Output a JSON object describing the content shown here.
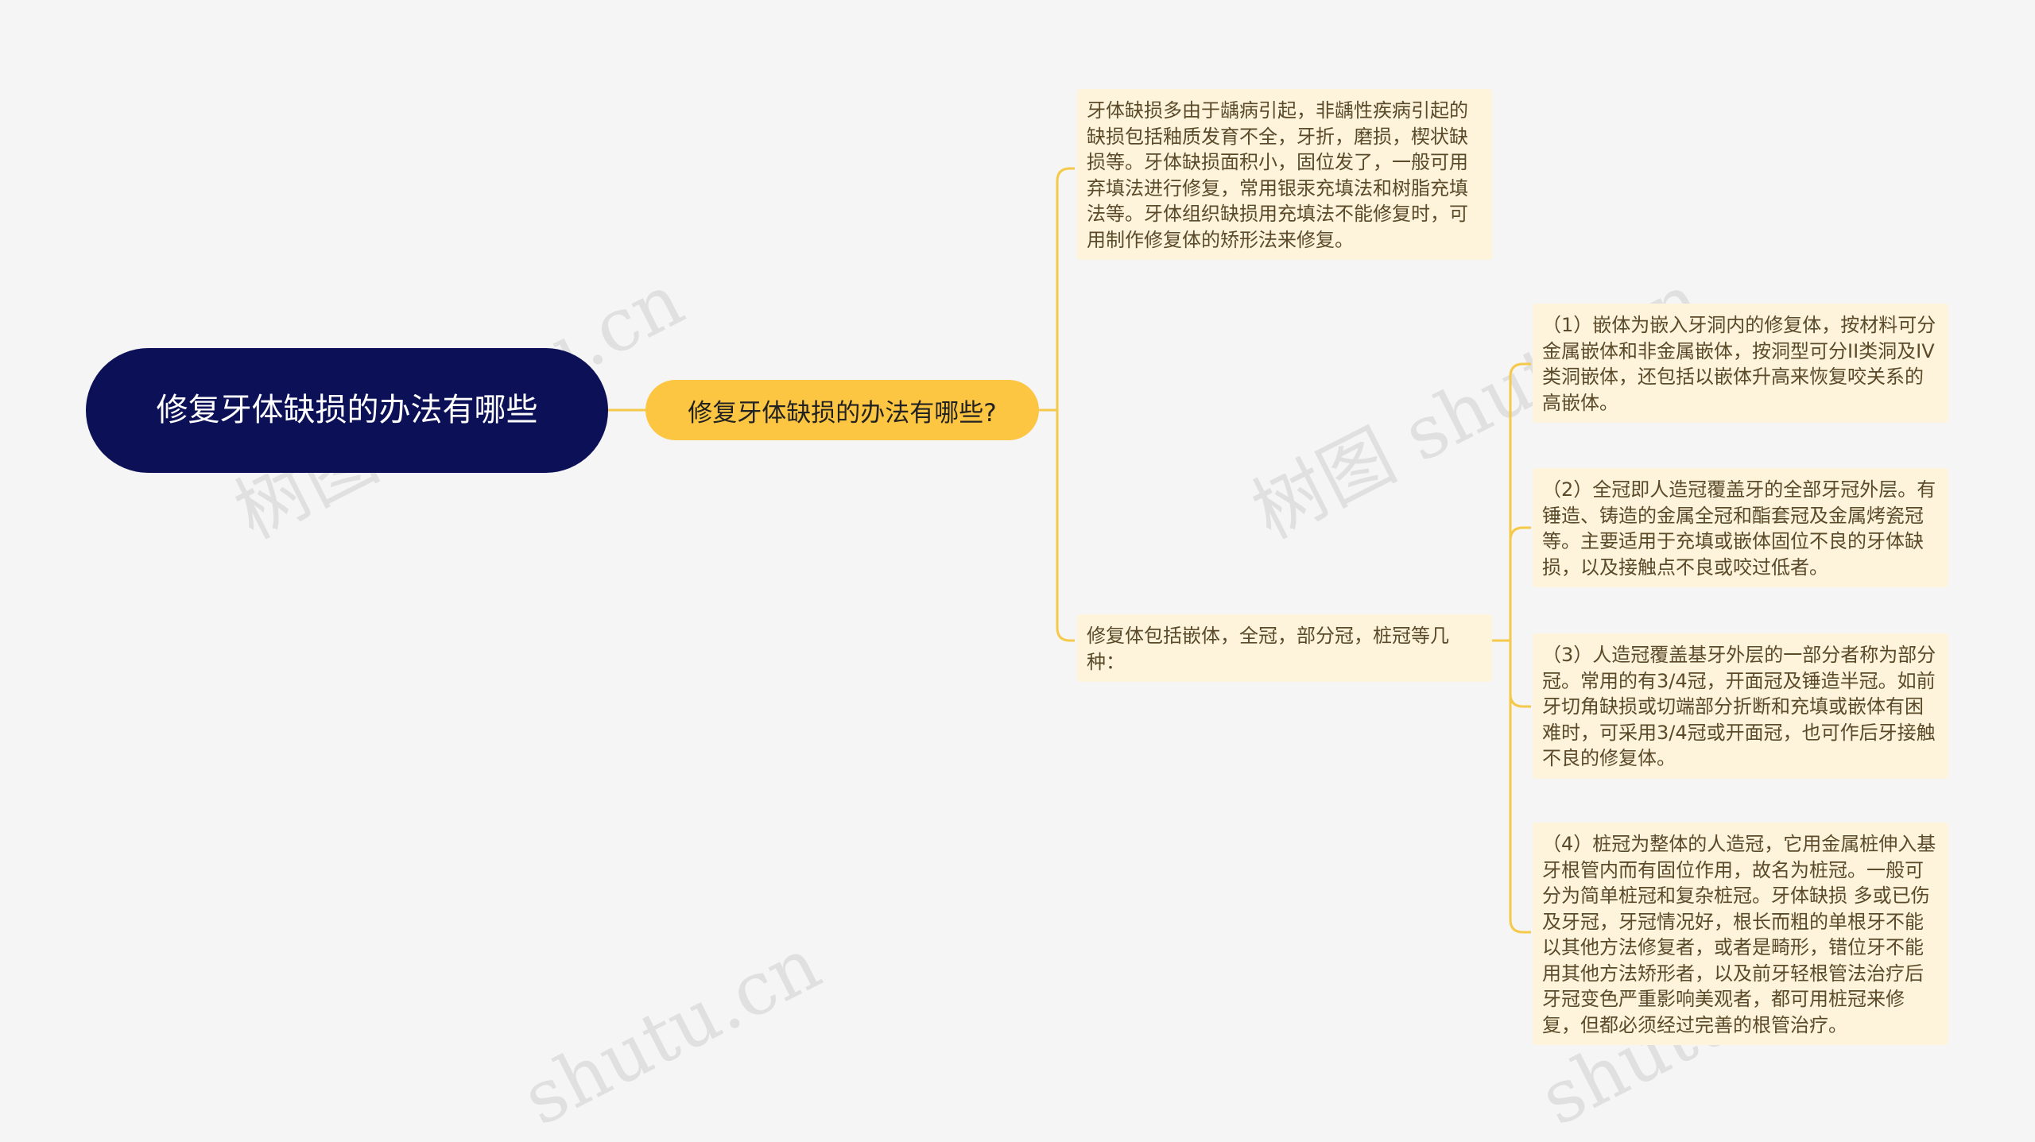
{
  "root": {
    "title": "修复牙体缺损的办法有哪些"
  },
  "main": {
    "title": "修复牙体缺损的办法有哪些?"
  },
  "branches": [
    {
      "text": "牙体缺损多由于龋病引起，非龋性疾病引起的缺损包括釉质发育不全，牙折，磨损，楔状缺损等。牙体缺损面积小，固位发了，一般可用弃填法进行修复，常用银汞充填法和树脂充填法等。牙体组织缺损用充填法不能修复时，可用制作修复体的矫形法来修复。"
    },
    {
      "text": "修复体包括嵌体，全冠，部分冠，桩冠等几种："
    }
  ],
  "sub_items": [
    {
      "text": "（1）嵌体为嵌入牙洞内的修复体，按材料可分金属嵌体和非金属嵌体，按洞型可分II类洞及IV类洞嵌体，还包括以嵌体升高来恢复咬关系的高嵌体。"
    },
    {
      "text": "（2）全冠即人造冠覆盖牙的全部牙冠外层。有锤造、铸造的金属全冠和酯套冠及金属烤瓷冠等。主要适用于充填或嵌体固位不良的牙体缺损，以及接触点不良或咬过低者。"
    },
    {
      "text": "（3）人造冠覆盖基牙外层的一部分者称为部分冠。常用的有3/4冠，开面冠及锤造半冠。如前牙切角缺损或切端部分折断和充填或嵌体有困难时，可采用3/4冠或开面冠，也可作后牙接触不良的修复体。"
    },
    {
      "text": "（4）桩冠为整体的人造冠，它用金属桩伸入基牙根管内而有固位作用，故名为桩冠。一般可分为简单桩冠和复杂桩冠。牙体缺损 多或已伤及牙冠，牙冠情况好，根长而粗的单根牙不能以其他方法修复者，或者是畸形，错位牙不能用其他方法矫形者，以及前牙轻根管法治疗后牙冠变色严重影响美观者，都可用桩冠来修复，但都必须经过完善的根管治疗。"
    }
  ],
  "watermarks": [
    "树图 shutu.cn",
    "树图 shutu.cn",
    "shutu.cn",
    "shutu.cn"
  ],
  "colors": {
    "root_bg": "#0c1157",
    "main_bg": "#fcc542",
    "leaf_bg": "#fdf4db",
    "line": "#f5c94a",
    "background": "#f5f5f5"
  }
}
